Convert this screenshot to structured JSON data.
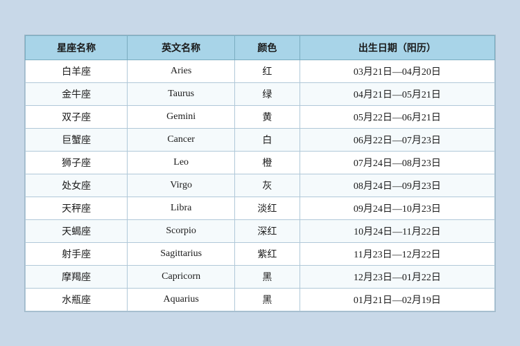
{
  "table": {
    "headers": [
      "星座名称",
      "英文名称",
      "颜色",
      "出生日期（阳历）"
    ],
    "rows": [
      {
        "chinese": "白羊座",
        "english": "Aries",
        "color": "红",
        "date": "03月21日—04月20日"
      },
      {
        "chinese": "金牛座",
        "english": "Taurus",
        "color": "绿",
        "date": "04月21日—05月21日"
      },
      {
        "chinese": "双子座",
        "english": "Gemini",
        "color": "黄",
        "date": "05月22日—06月21日"
      },
      {
        "chinese": "巨蟹座",
        "english": "Cancer",
        "color": "白",
        "date": "06月22日—07月23日"
      },
      {
        "chinese": "狮子座",
        "english": "Leo",
        "color": "橙",
        "date": "07月24日—08月23日"
      },
      {
        "chinese": "处女座",
        "english": "Virgo",
        "color": "灰",
        "date": "08月24日—09月23日"
      },
      {
        "chinese": "天秤座",
        "english": "Libra",
        "color": "淡红",
        "date": "09月24日—10月23日"
      },
      {
        "chinese": "天蝎座",
        "english": "Scorpio",
        "color": "深红",
        "date": "10月24日—11月22日"
      },
      {
        "chinese": "射手座",
        "english": "Sagittarius",
        "color": "紫红",
        "date": "11月23日—12月22日"
      },
      {
        "chinese": "摩羯座",
        "english": "Capricorn",
        "color": "黑",
        "date": "12月23日—01月22日"
      },
      {
        "chinese": "水瓶座",
        "english": "Aquarius",
        "color": "黑",
        "date": "01月21日—02月19日"
      }
    ]
  }
}
